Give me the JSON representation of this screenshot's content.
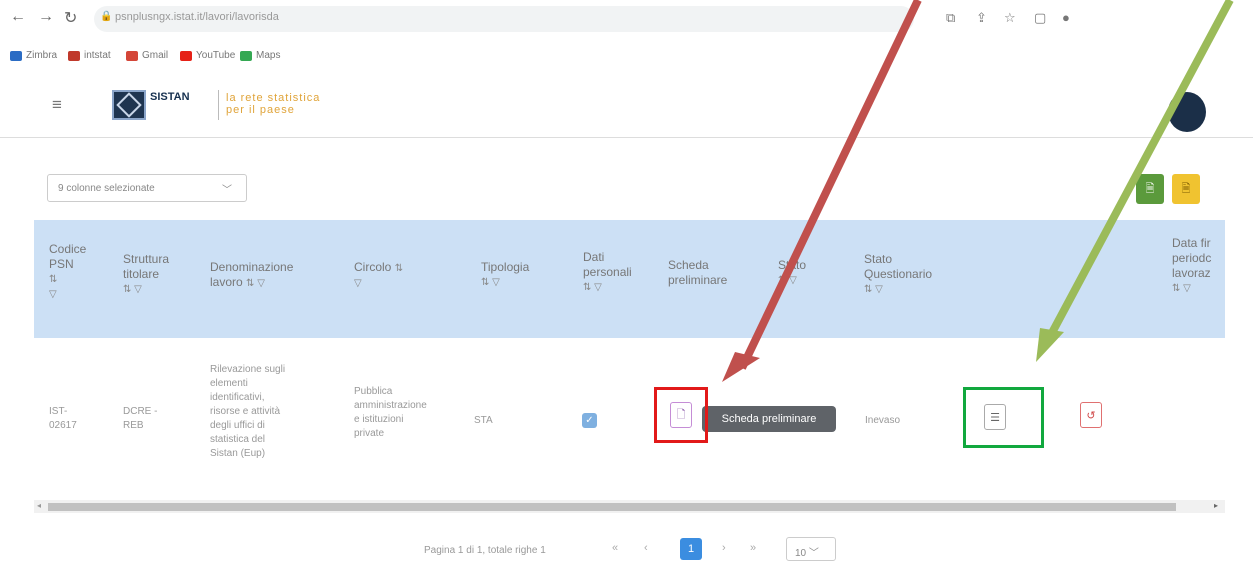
{
  "browser": {
    "url": "psnplusngx.istat.it/lavori/lavorisda",
    "bookmarks": [
      {
        "label": "Zimbra",
        "color": "#2b6cc4"
      },
      {
        "label": "intstat",
        "color": "#c0392b"
      },
      {
        "label": "Gmail",
        "color": "#d44638"
      },
      {
        "label": "YouTube",
        "color": "#e62117"
      },
      {
        "label": "Maps",
        "color": "#34a853"
      }
    ]
  },
  "header": {
    "brand": "SISTAN",
    "tagline_line1": "la rete statistica",
    "tagline_line2": "per il paese"
  },
  "toolbar": {
    "columns_selected": "9 colonne selezionate",
    "export_excel_color": "#5b9a3c",
    "export_pdf_color": "#f0c330"
  },
  "table": {
    "columns": {
      "codice": {
        "l1": "Codice",
        "l2": "PSN"
      },
      "struttura": {
        "l1": "Struttura",
        "l2": "titolare"
      },
      "denominazione": {
        "l1": "Denominazione",
        "l2": "lavoro"
      },
      "circolo": {
        "l1": "Circolo"
      },
      "tipologia": {
        "l1": "Tipologia"
      },
      "dati": {
        "l1": "Dati",
        "l2": "personali"
      },
      "scheda": {
        "l1": "Scheda",
        "l2": "preliminare"
      },
      "stato": {
        "l1": "Stato"
      },
      "stato_questionario": {
        "l1": "Stato",
        "l2": "Questionario"
      },
      "data_fine": {
        "l1": "Data fir",
        "l2": "periodc",
        "l3": "lavoraz"
      }
    },
    "row": {
      "codice": [
        "IST-",
        "02617"
      ],
      "struttura": [
        "DCRE -",
        "REB"
      ],
      "denominazione": [
        "Rilevazione sugli",
        "elementi",
        "identificativi,",
        "risorse e attività",
        "degli uffici di",
        "statistica del",
        "Sistan (Eup)"
      ],
      "circolo": [
        "Pubblica",
        "amministrazione",
        "e istituzioni",
        "private"
      ],
      "tipologia": "STA",
      "stato_questionario": "Inevaso",
      "tooltip": "Scheda preliminare"
    }
  },
  "paginator": {
    "summary": "Pagina 1 di 1, totale righe 1",
    "first": "«",
    "prev": "‹",
    "current": "1",
    "next": "›",
    "last": "»",
    "page_size": "10"
  },
  "annotations": {
    "red_color": "#c0504d",
    "green_color": "#9bbb59"
  }
}
